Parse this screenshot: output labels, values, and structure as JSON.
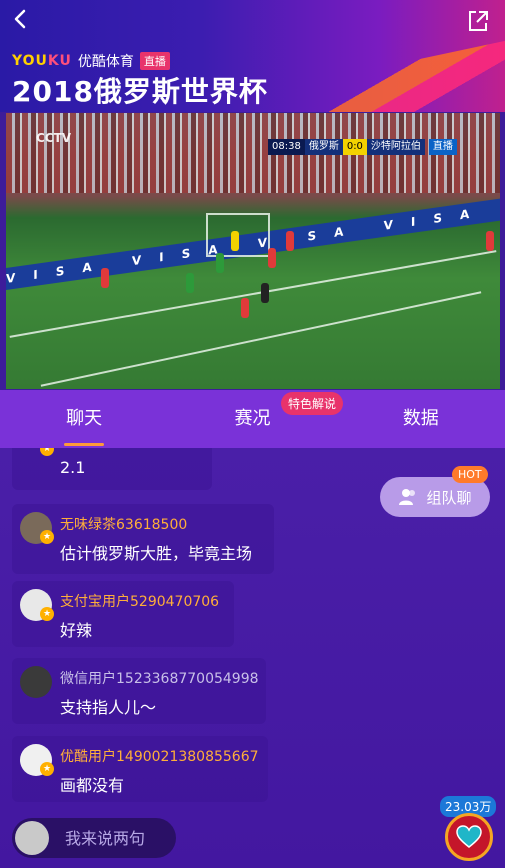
{
  "header": {
    "brand_name_y": "YOU",
    "brand_name_k": "KU",
    "brand_sub": "优酷体育",
    "live_tag": "直播",
    "title": "2018俄罗斯世界杯"
  },
  "video": {
    "watermark": "CCTV",
    "ad_text": "VISA VISA VISA VISA VISA VISA VISA VISA",
    "scoreboard": {
      "time": "08:38",
      "home": "俄罗斯",
      "score": "0:0",
      "away": "沙特阿拉伯",
      "live": "直播"
    }
  },
  "tabs": [
    {
      "label": "聊天",
      "active": true
    },
    {
      "label": "赛况",
      "active": false
    },
    {
      "label": "数据",
      "active": false
    }
  ],
  "tab_badge": "特色解说",
  "team_chat": {
    "label": "组队聊",
    "hot": "HOT"
  },
  "messages": [
    {
      "user": "",
      "text": "2.1"
    },
    {
      "user": "无味绿茶63618500",
      "text": "估计俄罗斯大胜，毕竟主场"
    },
    {
      "user": "支付宝用户5290470706",
      "text": "好辣"
    },
    {
      "user": "微信用户1523368770054998",
      "text": "支持指人儿～"
    },
    {
      "user": "优酷用户1490021380855667",
      "text": "画都没有"
    }
  ],
  "input": {
    "placeholder": "我来说两句"
  },
  "like_count": "23.03万",
  "colors": {
    "accent": "#7a32d8",
    "username_orange": "#ffae3a",
    "badge_pink": "#e8336b"
  }
}
